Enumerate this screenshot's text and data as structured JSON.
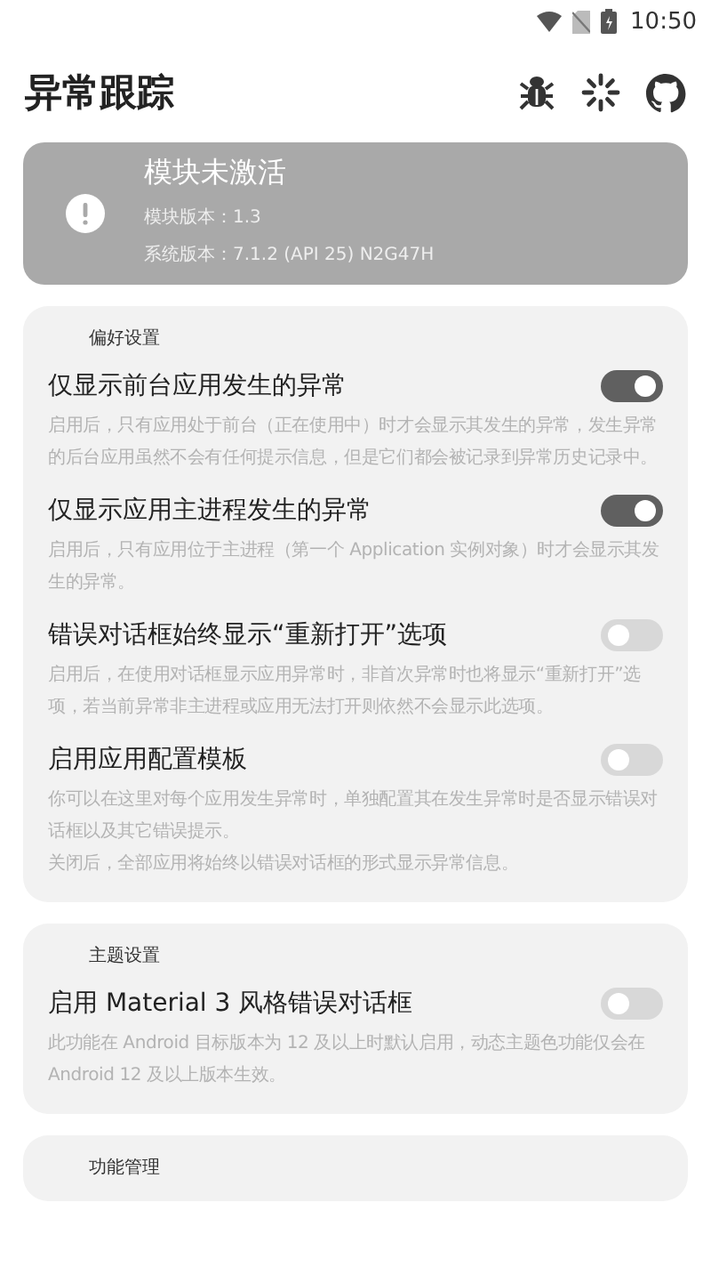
{
  "status_bar": {
    "time": "10:50"
  },
  "app_bar": {
    "title": "异常跟踪",
    "actions": [
      {
        "kind": "bug"
      },
      {
        "kind": "loading"
      },
      {
        "kind": "github"
      }
    ]
  },
  "banner": {
    "title": "模块未激活",
    "lines": [
      "模块版本：1.3",
      "系统版本：7.1.2 (API 25) N2G47H"
    ]
  },
  "sections": [
    {
      "header": "偏好设置",
      "items": [
        {
          "title": "仅显示前台应用发生的异常",
          "on": true,
          "description": [
            "启用后，只有应用处于前台（正在使用中）时才会显示其发生的异常，发生异常的后台应用虽然不会有任何提示信息，但是它们都会被记录到异常历史记录中。"
          ]
        },
        {
          "title": "仅显示应用主进程发生的异常",
          "on": true,
          "description": [
            "启用后，只有应用位于主进程（第一个 Application 实例对象）时才会显示其发生的异常。"
          ]
        },
        {
          "title": "错误对话框始终显示“重新打开”选项",
          "on": false,
          "description": [
            "启用后，在使用对话框显示应用异常时，非首次异常时也将显示“重新打开”选项，若当前异常非主进程或应用无法打开则依然不会显示此选项。"
          ]
        },
        {
          "title": "启用应用配置模板",
          "on": false,
          "description": [
            "你可以在这里对每个应用发生异常时，单独配置其在发生异常时是否显示错误对话框以及其它错误提示。",
            "关闭后，全部应用将始终以错误对话框的形式显示异常信息。"
          ]
        }
      ]
    },
    {
      "header": "主题设置",
      "items": [
        {
          "title": "启用 Material 3 风格错误对话框",
          "on": false,
          "description": [
            "此功能在 Android 目标版本为 12 及以上时默认启用，动态主题色功能仅会在 Android 12 及以上版本生效。"
          ]
        }
      ]
    },
    {
      "header": "功能管理"
    }
  ]
}
